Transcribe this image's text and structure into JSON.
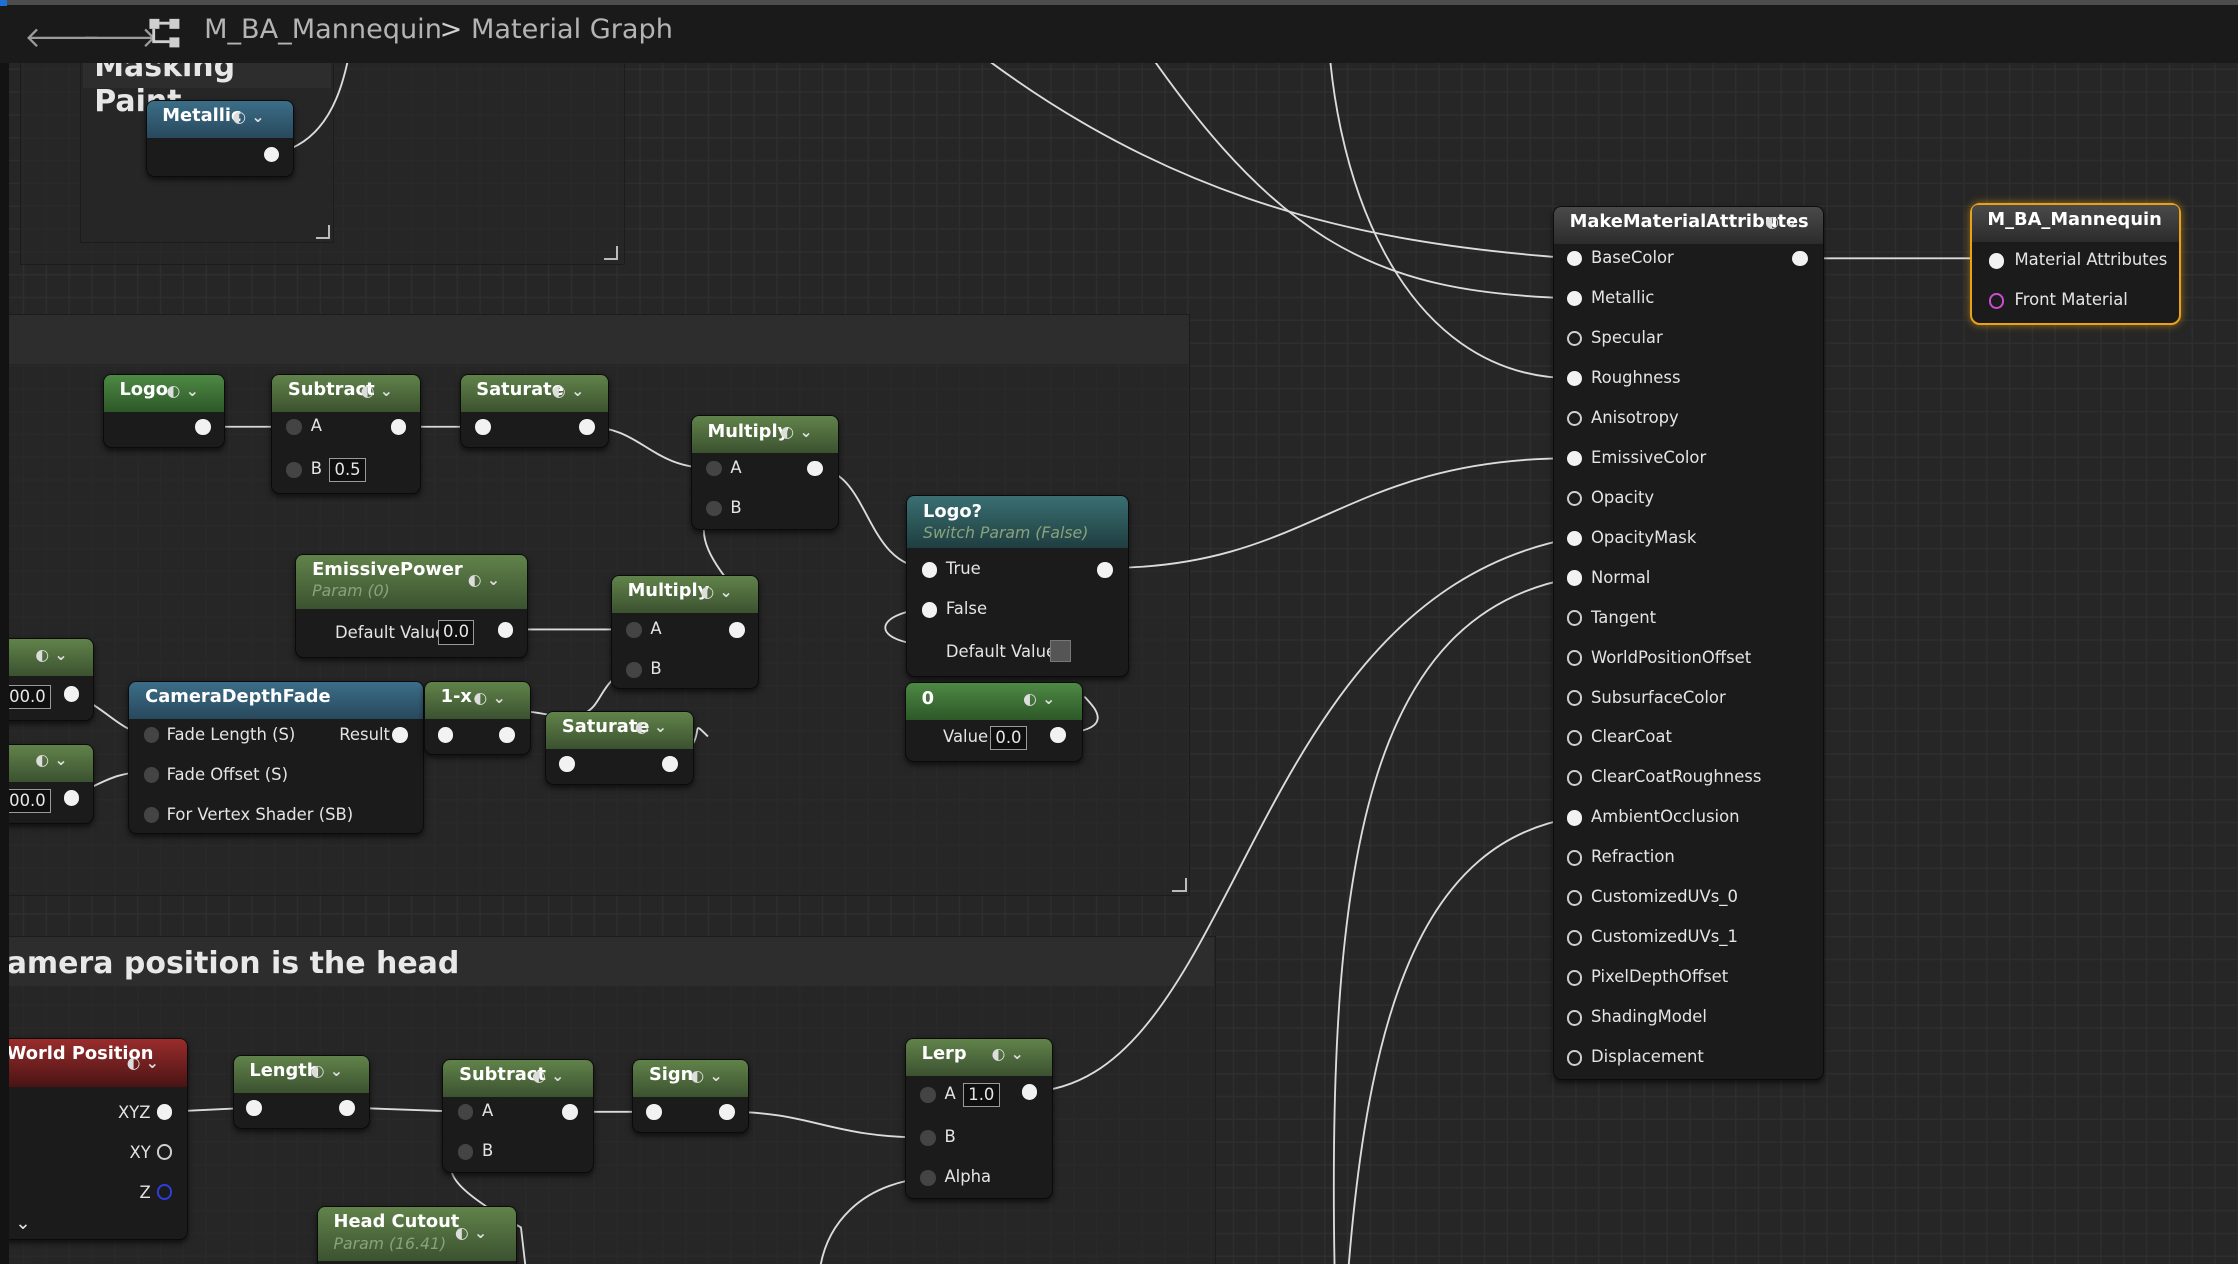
{
  "breadcrumb": {
    "asset": "M_BA_Mannequin",
    "sep": ">",
    "graph": "Material Graph"
  },
  "comments": {
    "masking_paint": "Masking Paint",
    "camera_head": "amera position is the head"
  },
  "nodes": {
    "metallic": {
      "title": "Metallic"
    },
    "logo": {
      "title": "Logo"
    },
    "subtract1": {
      "title": "Subtract",
      "a": "A",
      "b": "B",
      "b_value": "0.5"
    },
    "saturate1": {
      "title": "Saturate"
    },
    "multiply1": {
      "title": "Multiply",
      "a": "A",
      "b": "B"
    },
    "logo_switch": {
      "title": "Logo?",
      "subtitle": "Switch Param (False)",
      "true": "True",
      "false": "False",
      "default": "Default Value"
    },
    "emissive_power": {
      "title": "EmissivePower",
      "subtitle": "Param (0)",
      "default": "Default Value",
      "value": "0.0"
    },
    "multiply2": {
      "title": "Multiply",
      "a": "A",
      "b": "B"
    },
    "left_const1": {
      "value": "00.0"
    },
    "left_const2": {
      "value": "00.0"
    },
    "camera_depth_fade": {
      "title": "CameraDepthFade",
      "fade_length": "Fade Length (S)",
      "fade_offset": "Fade Offset (S)",
      "vertex": "For Vertex Shader (SB)",
      "result": "Result"
    },
    "one_minus": {
      "title": "1-x"
    },
    "saturate2": {
      "title": "Saturate"
    },
    "const_zero": {
      "title": "0",
      "value_label": "Value",
      "value": "0.0"
    },
    "make_material_attributes": {
      "title": "MakeMaterialAttributes",
      "pins": [
        "BaseColor",
        "Metallic",
        "Specular",
        "Roughness",
        "Anisotropy",
        "EmissiveColor",
        "Opacity",
        "OpacityMask",
        "Normal",
        "Tangent",
        "WorldPositionOffset",
        "SubsurfaceColor",
        "ClearCoat",
        "ClearCoatRoughness",
        "AmbientOcclusion",
        "Refraction",
        "CustomizedUVs_0",
        "CustomizedUVs_1",
        "PixelDepthOffset",
        "ShadingModel",
        "Displacement"
      ]
    },
    "output": {
      "title": "M_BA_Mannequin",
      "material_attributes": "Material Attributes",
      "front_material": "Front Material"
    },
    "world_position": {
      "title": "World Position",
      "xyz": "XYZ",
      "xy": "XY",
      "z": "Z"
    },
    "length": {
      "title": "Length"
    },
    "subtract2": {
      "title": "Subtract",
      "a": "A",
      "b": "B"
    },
    "sign": {
      "title": "Sign"
    },
    "lerp": {
      "title": "Lerp",
      "a": "A",
      "a_value": "1.0",
      "b": "B",
      "alpha": "Alpha"
    },
    "head_cutout": {
      "title": "Head Cutout",
      "subtitle": "Param (16.41)"
    }
  },
  "colors": {
    "selection": "#e8a21a",
    "background": "#262626",
    "pin_purple": "#c94ed0"
  }
}
